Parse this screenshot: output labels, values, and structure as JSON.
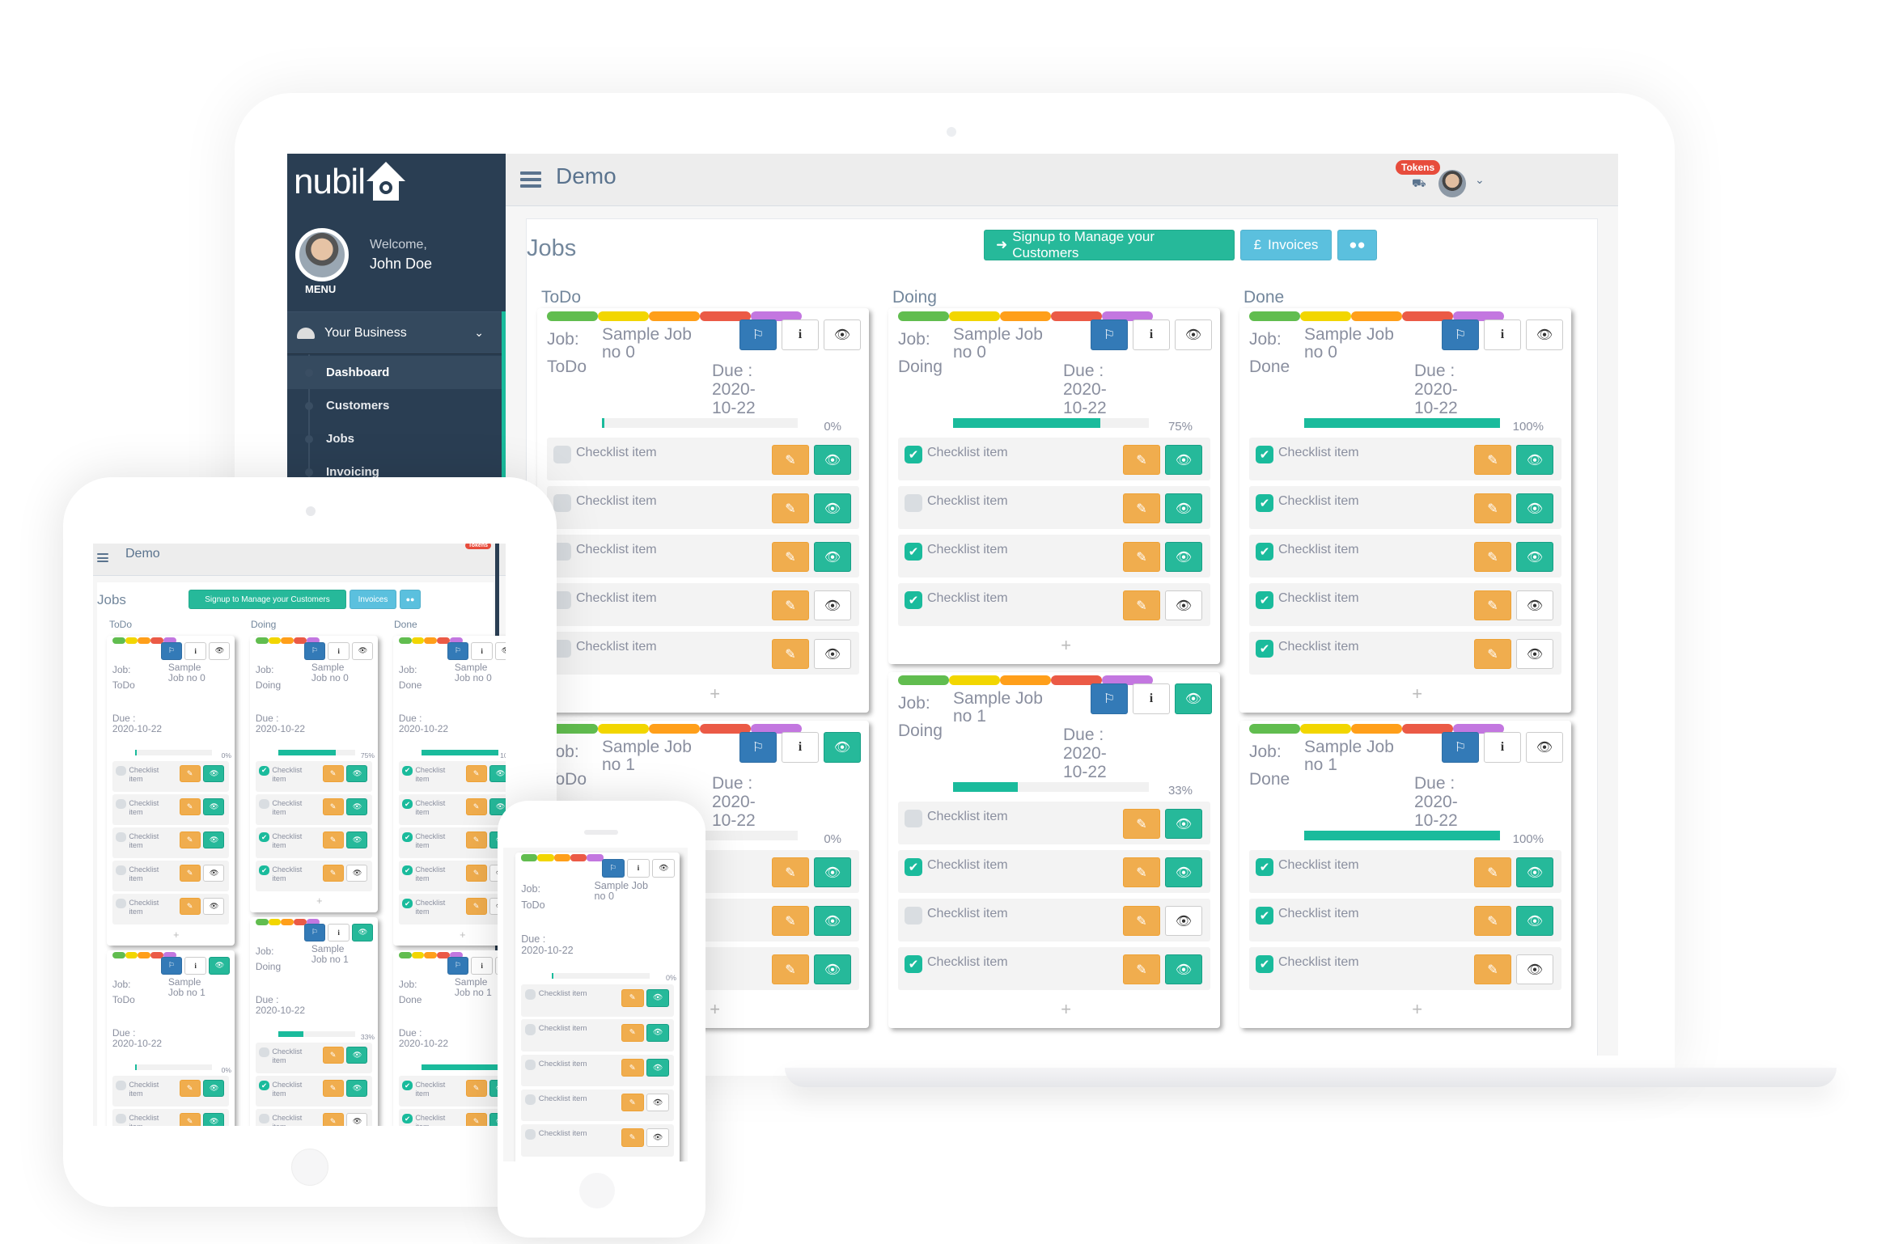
{
  "app": {
    "logo_text": "nubil",
    "page_name": "Demo",
    "tokens_badge": "Tokens"
  },
  "sidebar": {
    "welcome": "Welcome,",
    "username": "John Doe",
    "menu_label": "MENU",
    "section": "Your Business",
    "items": [
      {
        "label": "Dashboard",
        "active": true
      },
      {
        "label": "Customers",
        "active": false
      },
      {
        "label": "Jobs",
        "active": false
      },
      {
        "label": "Invoicing",
        "active": false
      }
    ]
  },
  "main": {
    "title": "Jobs",
    "buttons": {
      "signup": "Signup to Manage your Customers",
      "invoices": "Invoices"
    },
    "label_colors": [
      "#61bd4f",
      "#f2d600",
      "#ff9f1a",
      "#eb5a46",
      "#c377e0"
    ],
    "colors": {
      "teal": "#26b99a",
      "blue": "#337ab7",
      "orange": "#f0ad4e",
      "info": "#5bc0de",
      "sidebar": "#2a3e53"
    },
    "columns": [
      {
        "title": "ToDo",
        "cards": [
          {
            "job_label": "Job:",
            "status": "ToDo",
            "name": "Sample Job no 0",
            "due_label": "Due :",
            "due": "2020-10-22",
            "progress": 0,
            "progress_text": "0%",
            "visible": false,
            "checklist": [
              {
                "text": "Checklist item",
                "checked": false,
                "visible": true
              },
              {
                "text": "Checklist item",
                "checked": false,
                "visible": true
              },
              {
                "text": "Checklist item",
                "checked": false,
                "visible": true
              },
              {
                "text": "Checklist item",
                "checked": false,
                "visible": false
              },
              {
                "text": "Checklist item",
                "checked": false,
                "visible": false
              }
            ]
          },
          {
            "job_label": "Job:",
            "status": "ToDo",
            "name": "Sample Job no 1",
            "due_label": "Due :",
            "due": "2020-10-22",
            "progress": 0,
            "progress_text": "0%",
            "visible": true,
            "checklist": [
              {
                "text": "Checklist item",
                "checked": false,
                "visible": true
              },
              {
                "text": "Checklist item",
                "checked": false,
                "visible": true
              },
              {
                "text": "Checklist item",
                "checked": false,
                "visible": true
              }
            ]
          }
        ]
      },
      {
        "title": "Doing",
        "cards": [
          {
            "job_label": "Job:",
            "status": "Doing",
            "name": "Sample Job no 0",
            "due_label": "Due :",
            "due": "2020-10-22",
            "progress": 75,
            "progress_text": "75%",
            "visible": false,
            "checklist": [
              {
                "text": "Checklist item",
                "checked": true,
                "visible": true
              },
              {
                "text": "Checklist item",
                "checked": false,
                "visible": true
              },
              {
                "text": "Checklist item",
                "checked": true,
                "visible": true
              },
              {
                "text": "Checklist item",
                "checked": true,
                "visible": false
              }
            ]
          },
          {
            "job_label": "Job:",
            "status": "Doing",
            "name": "Sample Job no 1",
            "due_label": "Due :",
            "due": "2020-10-22",
            "progress": 33,
            "progress_text": "33%",
            "visible": true,
            "checklist": [
              {
                "text": "Checklist item",
                "checked": false,
                "visible": true
              },
              {
                "text": "Checklist item",
                "checked": true,
                "visible": true
              },
              {
                "text": "Checklist item",
                "checked": false,
                "visible": false
              },
              {
                "text": "Checklist item",
                "checked": true,
                "visible": true
              }
            ]
          }
        ]
      },
      {
        "title": "Done",
        "cards": [
          {
            "job_label": "Job:",
            "status": "Done",
            "name": "Sample Job no 0",
            "due_label": "Due :",
            "due": "2020-10-22",
            "progress": 100,
            "progress_text": "100%",
            "visible": false,
            "checklist": [
              {
                "text": "Checklist item",
                "checked": true,
                "visible": true
              },
              {
                "text": "Checklist item",
                "checked": true,
                "visible": true
              },
              {
                "text": "Checklist item",
                "checked": true,
                "visible": true
              },
              {
                "text": "Checklist item",
                "checked": true,
                "visible": false
              },
              {
                "text": "Checklist item",
                "checked": true,
                "visible": false
              }
            ]
          },
          {
            "job_label": "Job:",
            "status": "Done",
            "name": "Sample Job no 1",
            "due_label": "Due :",
            "due": "2020-10-22",
            "progress": 100,
            "progress_text": "100%",
            "visible": false,
            "checklist": [
              {
                "text": "Checklist item",
                "checked": true,
                "visible": true
              },
              {
                "text": "Checklist item",
                "checked": true,
                "visible": true
              },
              {
                "text": "Checklist item",
                "checked": true,
                "visible": false
              }
            ]
          }
        ]
      }
    ],
    "add_symbol": "+"
  },
  "icons": {
    "flag": "⚐",
    "info": "i",
    "eye": "👁",
    "pencil": "✎",
    "check": "✔",
    "signin": "➜",
    "pound": "£",
    "users": "👥",
    "cart": "🛒",
    "chevron": "⌄"
  }
}
